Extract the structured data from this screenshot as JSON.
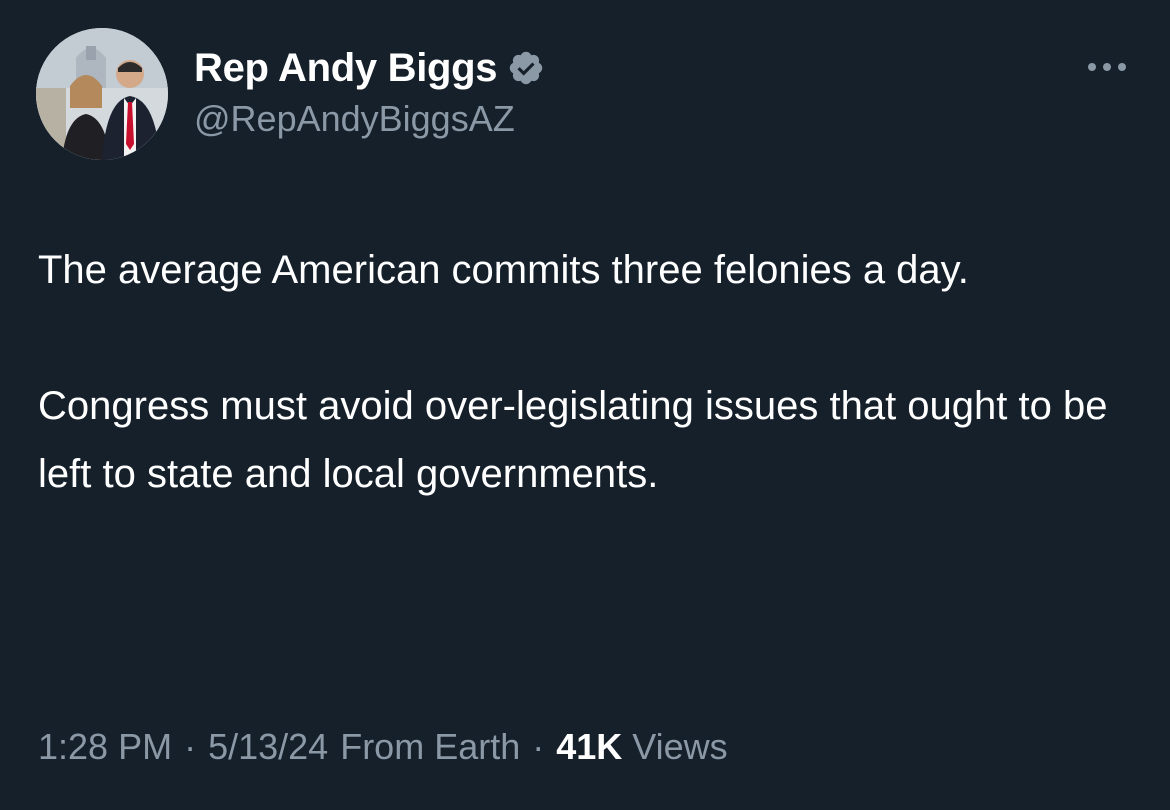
{
  "author": {
    "display_name": "Rep Andy Biggs",
    "handle": "@RepAndyBiggsAZ",
    "verified": true,
    "verified_badge_color": "#8b98a5",
    "avatar_icon": "profile-photo"
  },
  "menu": {
    "icon": "more-horizontal-icon"
  },
  "tweet": {
    "paragraphs": [
      "The average American commits three felonies a day.",
      "Congress must avoid over-legislating issues that ought to be left to state and local governments."
    ]
  },
  "meta": {
    "time": "1:28 PM",
    "date": "5/13/24",
    "source": "From Earth",
    "separator": "·",
    "views_count": "41K",
    "views_label": "Views"
  },
  "colors": {
    "background": "#15202b",
    "primary_text": "#ffffff",
    "secondary_text": "#8b98a5"
  }
}
